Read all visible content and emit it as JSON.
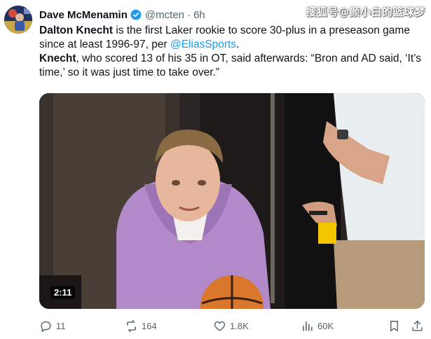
{
  "author": {
    "display_name": "Dave McMenamin",
    "handle": "@mcten",
    "separator": "·",
    "time": "6h",
    "verified": true
  },
  "watermark": "搜狐号@颜小白的篮球梦",
  "tweet": {
    "line1_name": "Dalton Knecht",
    "line1_rest": " is the first Laker rookie to score 30-plus in a preseason game since at least 1996-97, per ",
    "line1_mention": "@EliasSports",
    "line1_end": ".",
    "line2_name": "Knecht",
    "line2_rest": ", who scored 13 of his 35 in OT, said afterwards: “Bron and AD said, ‘It’s time,’ so it was just time to take over.”"
  },
  "media": {
    "duration": "2:11"
  },
  "actions": {
    "replies": "11",
    "reposts": "164",
    "likes": "1.8K",
    "views": "60K"
  },
  "colors": {
    "accent": "#1d9bf0",
    "secondary_text": "#536471",
    "primary_text": "#0f1419"
  },
  "icons": [
    "verified-badge-icon",
    "reply-icon",
    "repost-icon",
    "like-icon",
    "views-icon",
    "bookmark-icon",
    "share-icon"
  ]
}
